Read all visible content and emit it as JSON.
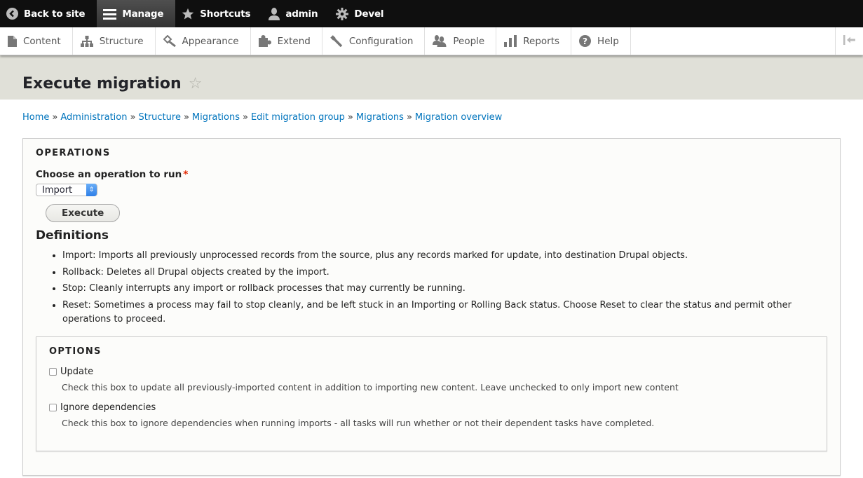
{
  "toolbar": {
    "items": [
      {
        "label": "Back to site",
        "icon": "back-arrow-circle-icon"
      },
      {
        "label": "Manage",
        "icon": "hamburger-menu-icon",
        "active": true
      },
      {
        "label": "Shortcuts",
        "icon": "star-icon"
      },
      {
        "label": "admin",
        "icon": "user-icon"
      },
      {
        "label": "Devel",
        "icon": "gear-icon"
      }
    ]
  },
  "tray": {
    "items": [
      {
        "label": "Content",
        "icon": "document-icon"
      },
      {
        "label": "Structure",
        "icon": "sitemap-icon"
      },
      {
        "label": "Appearance",
        "icon": "paintbrush-icon"
      },
      {
        "label": "Extend",
        "icon": "puzzle-icon"
      },
      {
        "label": "Configuration",
        "icon": "wrench-icon"
      },
      {
        "label": "People",
        "icon": "people-icon"
      },
      {
        "label": "Reports",
        "icon": "bar-chart-icon"
      },
      {
        "label": "Help",
        "icon": "help-circle-icon"
      }
    ]
  },
  "page": {
    "title": "Execute migration",
    "favorite_icon": "☆"
  },
  "breadcrumb": {
    "separator": "»",
    "items": [
      "Home",
      "Administration",
      "Structure",
      "Migrations",
      "Edit migration group",
      "Migrations",
      "Migration overview"
    ]
  },
  "operations": {
    "legend": "Operations",
    "field_label": "Choose an operation to run",
    "required_marker": "*",
    "select_value": "Import",
    "execute_label": "Execute",
    "definitions_title": "Definitions",
    "definitions": [
      "Import: Imports all previously unprocessed records from the source, plus any records marked for update, into destination Drupal objects.",
      "Rollback: Deletes all Drupal objects created by the import.",
      "Stop: Cleanly interrupts any import or rollback processes that may currently be running.",
      "Reset: Sometimes a process may fail to stop cleanly, and be left stuck in an Importing or Rolling Back status. Choose Reset to clear the status and permit other operations to proceed."
    ]
  },
  "options": {
    "legend": "Options",
    "items": [
      {
        "label": "Update",
        "checked": false,
        "description": "Check this box to update all previously-imported content in addition to importing new content. Leave unchecked to only import new content"
      },
      {
        "label": "Ignore dependencies",
        "checked": false,
        "description": "Check this box to ignore dependencies when running imports - all tasks will run whether or not their dependent tasks have completed."
      }
    ]
  },
  "colors": {
    "link": "#0074bd",
    "required": "#e32700",
    "toolbar_bg": "#0f0f0f",
    "header_bg": "#e0e0d8"
  }
}
